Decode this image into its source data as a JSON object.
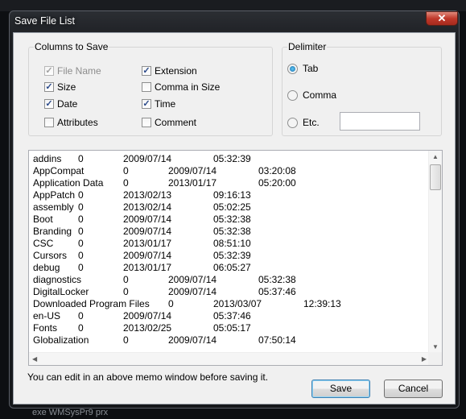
{
  "window": {
    "title": "Save File List",
    "close_glyph": "✕"
  },
  "columns_group": {
    "title": "Columns to Save",
    "options": [
      {
        "label": "File Name",
        "checked": true,
        "disabled": true
      },
      {
        "label": "Extension",
        "checked": true,
        "disabled": false
      },
      {
        "label": "Size",
        "checked": true,
        "disabled": false
      },
      {
        "label": "Comma in Size",
        "checked": false,
        "disabled": false
      },
      {
        "label": "Date",
        "checked": true,
        "disabled": false
      },
      {
        "label": "Time",
        "checked": true,
        "disabled": false
      },
      {
        "label": "Attributes",
        "checked": false,
        "disabled": false
      },
      {
        "label": "Comment",
        "checked": false,
        "disabled": false
      }
    ]
  },
  "delimiter_group": {
    "title": "Delimiter",
    "options": [
      {
        "label": "Tab",
        "selected": true
      },
      {
        "label": "Comma",
        "selected": false
      },
      {
        "label": "Etc.",
        "selected": false
      }
    ],
    "etc_value": ""
  },
  "memo": {
    "lines": [
      "addins\t0\t2009/07/14\t05:32:39",
      "AppCompat\t0\t2009/07/14\t03:20:08",
      "Application Data\t0\t2013/01/17\t05:20:00",
      "AppPatch\t0\t2013/02/13\t09:16:13",
      "assembly\t0\t2013/02/14\t05:02:25",
      "Boot\t0\t2009/07/14\t05:32:38",
      "Branding\t0\t2009/07/14\t05:32:38",
      "CSC\t0\t2013/01/17\t08:51:10",
      "Cursors\t0\t2009/07/14\t05:32:39",
      "debug\t0\t2013/01/17\t06:05:27",
      "diagnostics\t0\t2009/07/14\t05:32:38",
      "DigitalLocker\t0\t2009/07/14\t05:37:46",
      "Downloaded Program Files\t0\t2013/03/07\t12:39:13",
      "en-US\t0\t2009/07/14\t05:37:46",
      "Fonts\t0\t2013/02/25\t05:05:17",
      "Globalization\t0\t2009/07/14\t07:50:14"
    ]
  },
  "hint": "You can edit in an above memo window before saving it.",
  "buttons": {
    "save": "Save",
    "cancel": "Cancel"
  },
  "background": {
    "text": "exe    WMSysPr9    prx"
  }
}
